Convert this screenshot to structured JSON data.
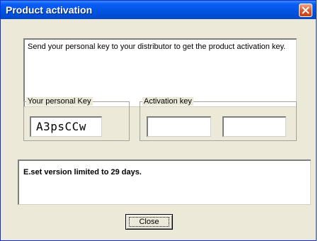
{
  "window": {
    "title": "Product activation",
    "close_icon": "close-icon",
    "accent": "#0054e3",
    "close_color": "#d9552b"
  },
  "message": {
    "text": "Send your personal key to your distributor to get the product activation key."
  },
  "personal_key": {
    "label": "Your personal Key",
    "value": "A3psCCw"
  },
  "activation_key": {
    "label": "Activation key",
    "field1_value": "",
    "field2_value": ""
  },
  "info": {
    "text": "E.set version limited to 29 days."
  },
  "buttons": {
    "close_label": "Close"
  }
}
